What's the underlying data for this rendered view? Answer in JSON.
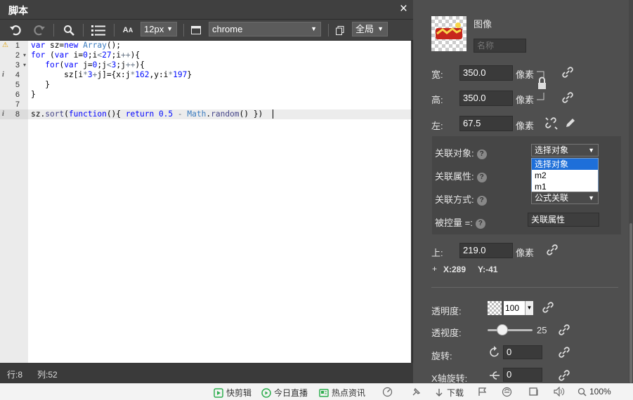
{
  "script_window": {
    "title": "脚本",
    "close": "×",
    "toolbar": {
      "font_size": "12px",
      "browser": "chrome",
      "scope": "全局"
    }
  },
  "editor": {
    "lines": [
      {
        "num": "1",
        "marker": "warning",
        "fold": ""
      },
      {
        "num": "2",
        "marker": "",
        "fold": "▾"
      },
      {
        "num": "3",
        "marker": "",
        "fold": "▾"
      },
      {
        "num": "4",
        "marker": "info",
        "fold": ""
      },
      {
        "num": "5",
        "marker": "",
        "fold": ""
      },
      {
        "num": "6",
        "marker": "",
        "fold": ""
      },
      {
        "num": "7",
        "marker": "",
        "fold": ""
      },
      {
        "num": "8",
        "marker": "info",
        "fold": ""
      }
    ],
    "code": [
      "var sz=new Array();",
      "for (var i=0;i<27;i++){",
      "   for(var j=0;j<3;j++){",
      "       sz[i*3+j]={x:j*162,y:i*197}",
      "   }",
      "}",
      "",
      "sz.sort(function(){ return 0.5 - Math.random() })"
    ]
  },
  "status": {
    "row_label": "行:",
    "row": "8",
    "col_label": "列:",
    "col": "52"
  },
  "panel": {
    "image_label": "图像",
    "name_placeholder": "名称",
    "width_label": "宽:",
    "width_value": "350.0",
    "height_label": "高:",
    "height_value": "350.0",
    "unit": "像素",
    "left_label": "左:",
    "left_value": "67.5",
    "link_target_label": "关联对象:",
    "link_target_value": "选择对象",
    "link_target_options": [
      "选择对象",
      "m2",
      "m1"
    ],
    "link_prop_label": "关联属性:",
    "link_mode_label": "关联方式:",
    "link_mode_value": "公式关联",
    "controlled_label": "被控量 =:",
    "controlled_value": "关联属性",
    "top_label": "上:",
    "top_value": "219.0",
    "coords_plus": "+",
    "coord_x": "X:289",
    "coord_y": "Y:-41",
    "opacity_label": "透明度:",
    "opacity_value": "100",
    "perspective_label": "透视度:",
    "perspective_value": "25",
    "rotate_label": "旋转:",
    "rotate_value": "0",
    "xrotate_label": "X轴旋转:",
    "xrotate_value": "0"
  },
  "browser_bar": {
    "items": [
      "快剪辑",
      "今日直播",
      "热点资讯",
      "下载"
    ],
    "zoom": "100%"
  }
}
